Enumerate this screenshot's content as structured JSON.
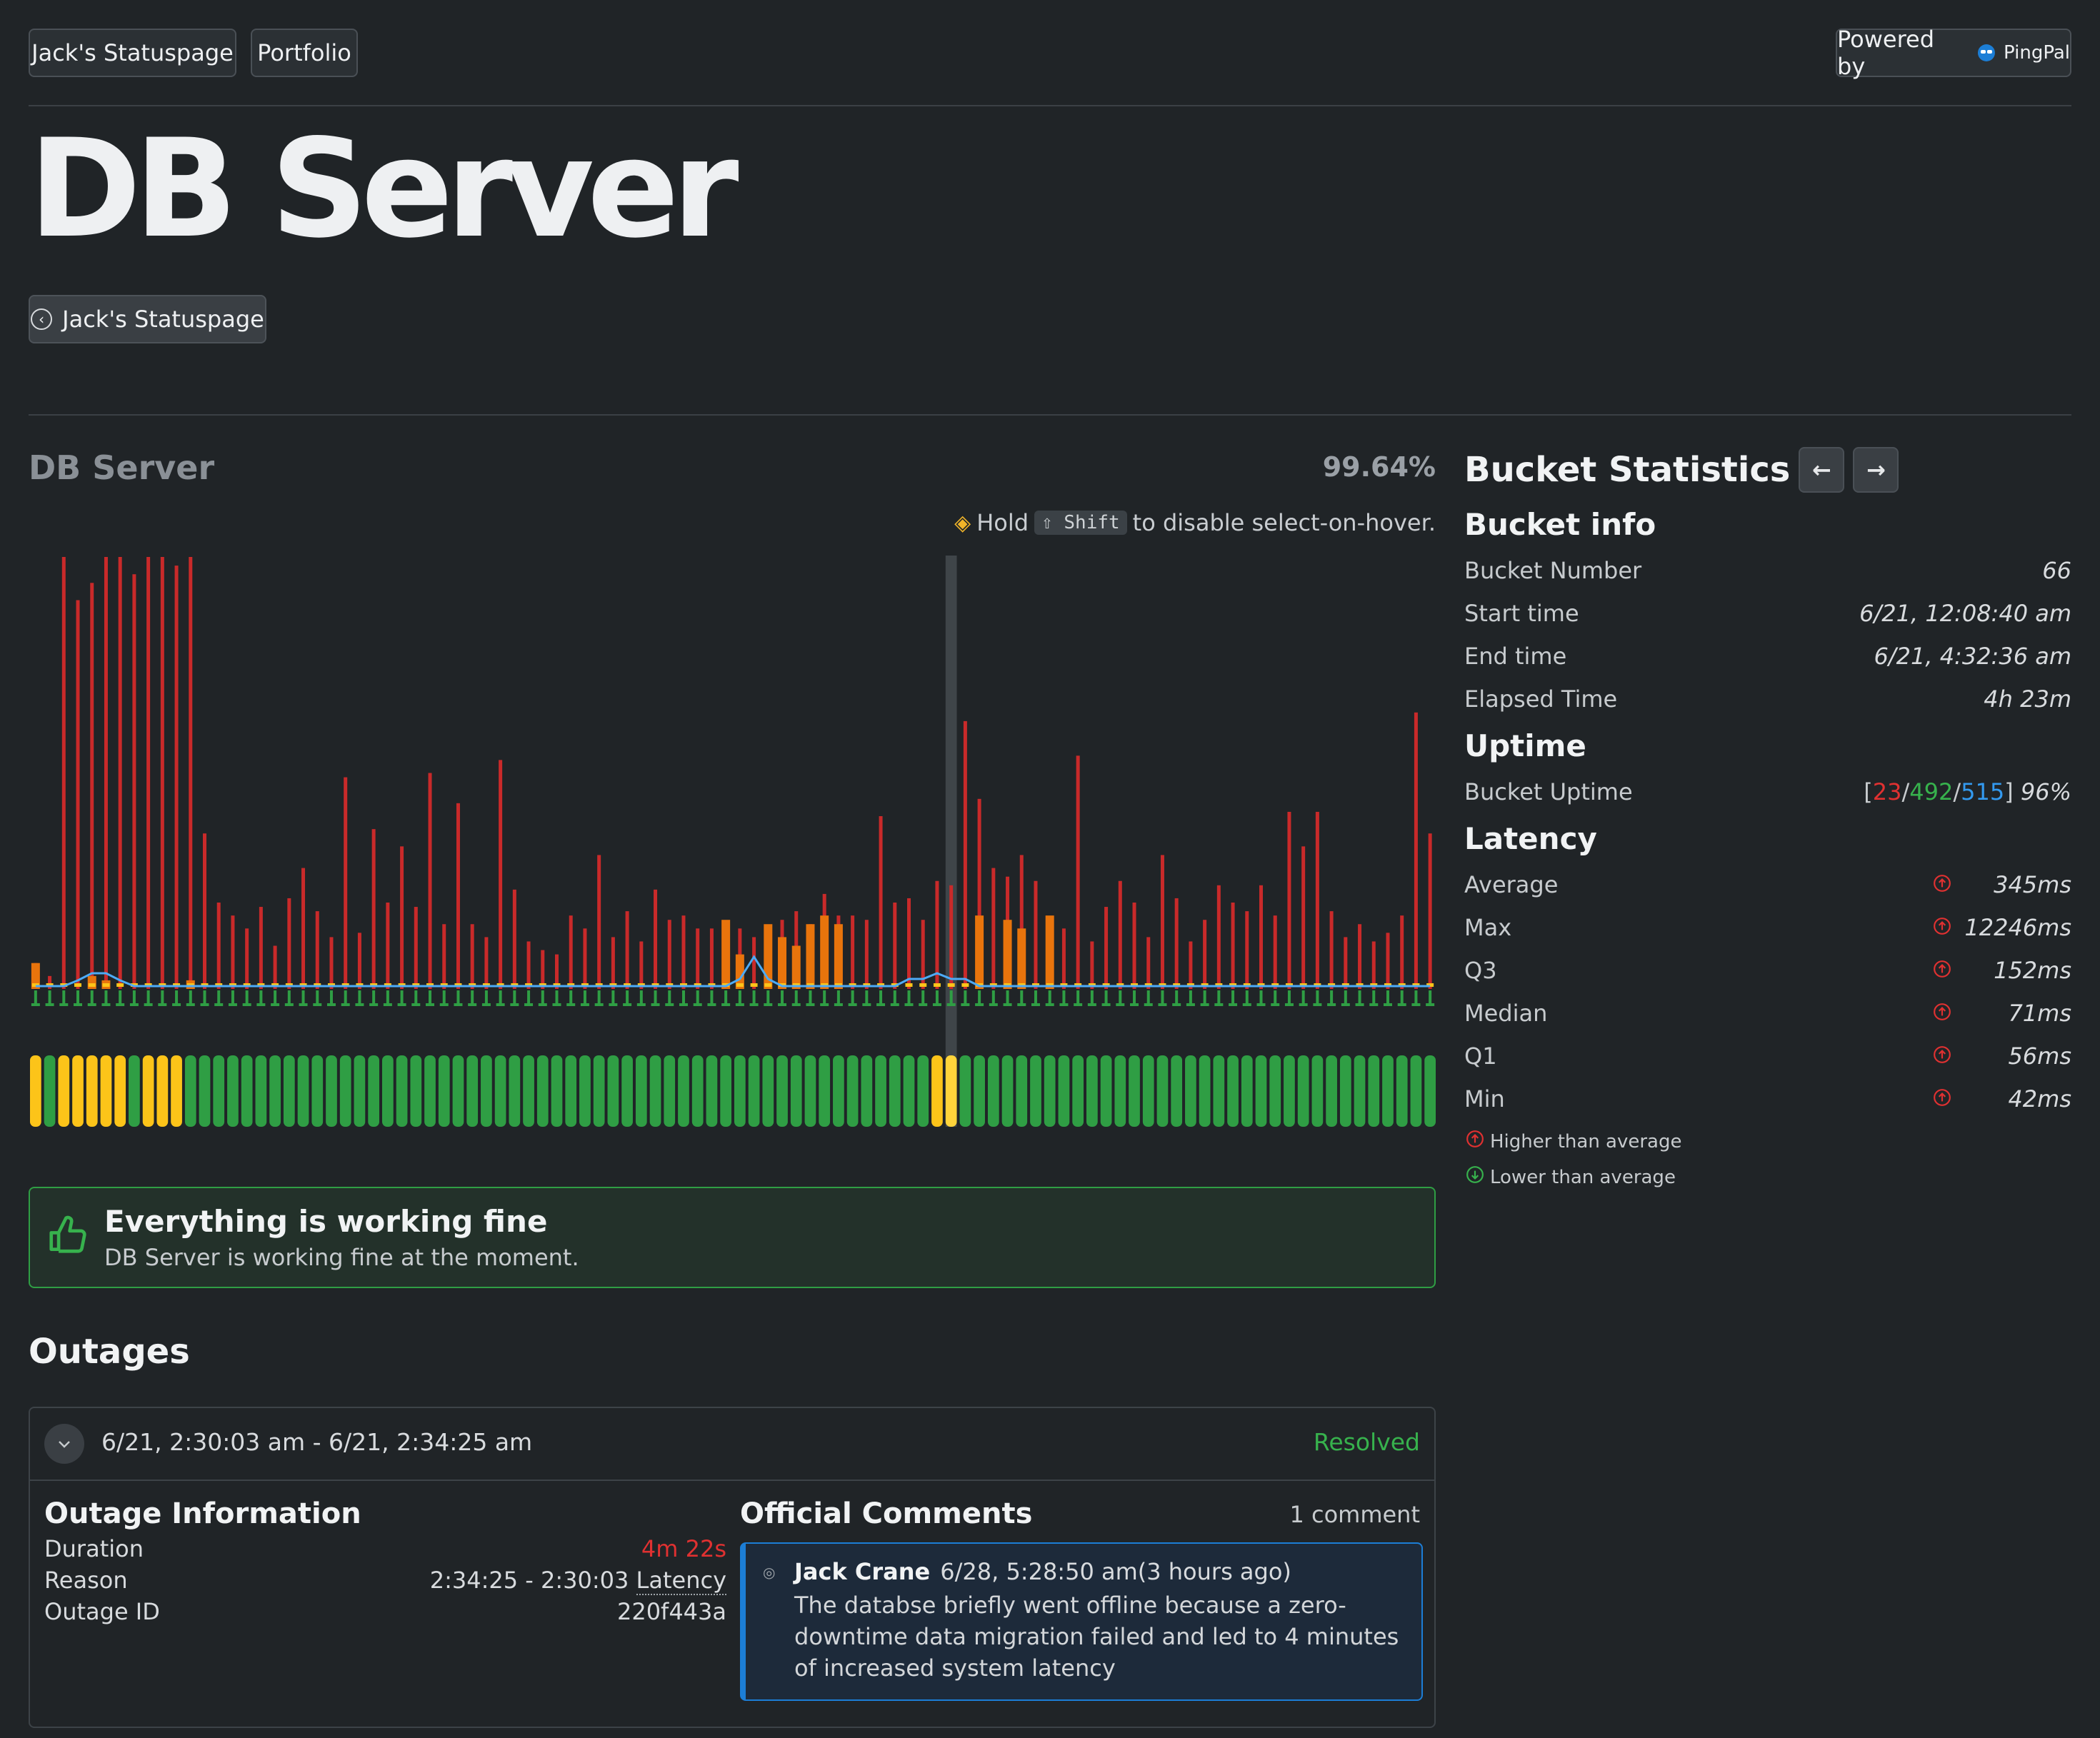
{
  "nav": {
    "home_label": "Jack's Statuspage",
    "portfolio_label": "Portfolio",
    "powered_by": "Powered by",
    "brand": "PingPal"
  },
  "page": {
    "title": "DB Server",
    "back_label": "Jack's Statuspage"
  },
  "monitor": {
    "name": "DB Server",
    "uptime_percent": "99.64%",
    "hint_prefix": "Hold",
    "hint_key": "⇧ Shift",
    "hint_suffix": "to disable select-on-hover.",
    "selected_bucket_index": 65,
    "colors": {
      "downtime": "#c92a2a",
      "degraded": "#e8740c",
      "latency_line": "#4dabf7",
      "up": "#2f9e44",
      "warning": "#fcc419",
      "selected": "#ffd43b"
    }
  },
  "chart_data": {
    "type": "bar",
    "title": "",
    "description": "",
    "bucket_count": 100,
    "red_spike_heights": [
      0.06,
      0.03,
      1.0,
      0.9,
      0.94,
      1.0,
      1.0,
      0.96,
      1.0,
      1.0,
      0.98,
      1.0,
      0.36,
      0.2,
      0.17,
      0.14,
      0.19,
      0.1,
      0.21,
      0.28,
      0.18,
      0.12,
      0.49,
      0.13,
      0.37,
      0.2,
      0.33,
      0.19,
      0.5,
      0.15,
      0.43,
      0.15,
      0.12,
      0.53,
      0.23,
      0.11,
      0.09,
      0.08,
      0.17,
      0.14,
      0.31,
      0.12,
      0.18,
      0.11,
      0.23,
      0.16,
      0.17,
      0.14,
      0.14,
      0.04,
      0.14,
      0.12,
      0.14,
      0.16,
      0.18,
      0.15,
      0.22,
      0.17,
      0.17,
      0.16,
      0.4,
      0.2,
      0.21,
      0.16,
      0.25,
      0.24,
      0.62,
      0.44,
      0.28,
      0.26,
      0.31,
      0.25,
      0.15,
      0.14,
      0.54,
      0.11,
      0.19,
      0.25,
      0.2,
      0.12,
      0.31,
      0.21,
      0.11,
      0.16,
      0.24,
      0.2,
      0.18,
      0.24,
      0.17,
      0.41,
      0.33,
      0.41,
      0.18,
      0.12,
      0.15,
      0.11,
      0.13,
      0.17,
      0.64,
      0.36
    ],
    "orange_heights": [
      0.06,
      0,
      0,
      0,
      0.03,
      0.02,
      0,
      0,
      0,
      0,
      0,
      0.02,
      0,
      0,
      0,
      0,
      0,
      0,
      0,
      0,
      0,
      0,
      0,
      0,
      0,
      0,
      0,
      0,
      0,
      0,
      0,
      0,
      0,
      0,
      0,
      0,
      0,
      0,
      0,
      0,
      0,
      0,
      0,
      0,
      0,
      0,
      0,
      0,
      0,
      0.16,
      0.08,
      0,
      0.15,
      0.12,
      0.1,
      0.15,
      0.17,
      0.15,
      0,
      0,
      0,
      0,
      0,
      0,
      0,
      0,
      0,
      0.17,
      0,
      0.16,
      0.14,
      0,
      0.17,
      0,
      0,
      0,
      0,
      0,
      0,
      0,
      0,
      0,
      0,
      0,
      0,
      0,
      0,
      0,
      0,
      0,
      0,
      0,
      0,
      0,
      0,
      0,
      0,
      0,
      0,
      0
    ],
    "status_bar": [
      "warning",
      "up",
      "warning",
      "warning",
      "warning",
      "warning",
      "warning",
      "up",
      "warning",
      "warning",
      "warning",
      "up",
      "up",
      "up",
      "up",
      "up",
      "up",
      "up",
      "up",
      "up",
      "up",
      "up",
      "up",
      "up",
      "up",
      "up",
      "up",
      "up",
      "up",
      "up",
      "up",
      "up",
      "up",
      "up",
      "up",
      "up",
      "up",
      "up",
      "up",
      "up",
      "up",
      "up",
      "up",
      "up",
      "up",
      "up",
      "up",
      "up",
      "up",
      "up",
      "up",
      "up",
      "up",
      "up",
      "up",
      "up",
      "up",
      "up",
      "up",
      "up",
      "up",
      "up",
      "up",
      "up",
      "warning",
      "up",
      "up",
      "up",
      "up",
      "up",
      "up",
      "up",
      "up",
      "up",
      "up",
      "up",
      "up",
      "up",
      "up",
      "up",
      "up",
      "up",
      "up",
      "up",
      "up",
      "up",
      "up",
      "up",
      "up",
      "up",
      "up",
      "up",
      "up",
      "up",
      "up",
      "up",
      "up",
      "up",
      "up",
      "up"
    ]
  },
  "notice": {
    "title": "Everything is working fine",
    "subtitle": "DB Server is working fine at the moment."
  },
  "outages": {
    "title": "Outages",
    "items": [
      {
        "range": "6/21, 2:30:03 am - 6/21, 2:34:25 am",
        "status": "Resolved",
        "info_title": "Outage Information",
        "duration_label": "Duration",
        "duration_value": "4m 22s",
        "reason_label": "Reason",
        "reason_value": "2:34:25 - 2:30:03",
        "reason_tag": "Latency",
        "id_label": "Outage ID",
        "id_value": "220f443a",
        "comments_title": "Official Comments",
        "comments_count": "1 comment",
        "comment": {
          "author": "Jack Crane",
          "time": "6/28, 5:28:50 am",
          "relative": "(3 hours ago)",
          "body": "The databse briefly went offline because a zero-downtime data migration failed and led to 4 minutes of increased system latency"
        }
      }
    ]
  },
  "bucket_stats": {
    "title": "Bucket Statistics",
    "info": {
      "title": "Bucket info",
      "number_label": "Bucket Number",
      "number_value": "66",
      "start_label": "Start time",
      "start_value": "6/21, 12:08:40 am",
      "end_label": "End time",
      "end_value": "6/21, 4:32:36 am",
      "elapsed_label": "Elapsed Time",
      "elapsed_value": "4h 23m"
    },
    "uptime": {
      "title": "Uptime",
      "label": "Bucket Uptime",
      "down": "23",
      "up": "492",
      "total": "515",
      "percent": "96%"
    },
    "latency": {
      "title": "Latency",
      "rows": [
        {
          "label": "Average",
          "value": "345ms"
        },
        {
          "label": "Max",
          "value": "12246ms"
        },
        {
          "label": "Q3",
          "value": "152ms"
        },
        {
          "label": "Median",
          "value": "71ms"
        },
        {
          "label": "Q1",
          "value": "56ms"
        },
        {
          "label": "Min",
          "value": "42ms"
        }
      ],
      "legend_higher": "Higher than average",
      "legend_lower": "Lower than average"
    }
  }
}
